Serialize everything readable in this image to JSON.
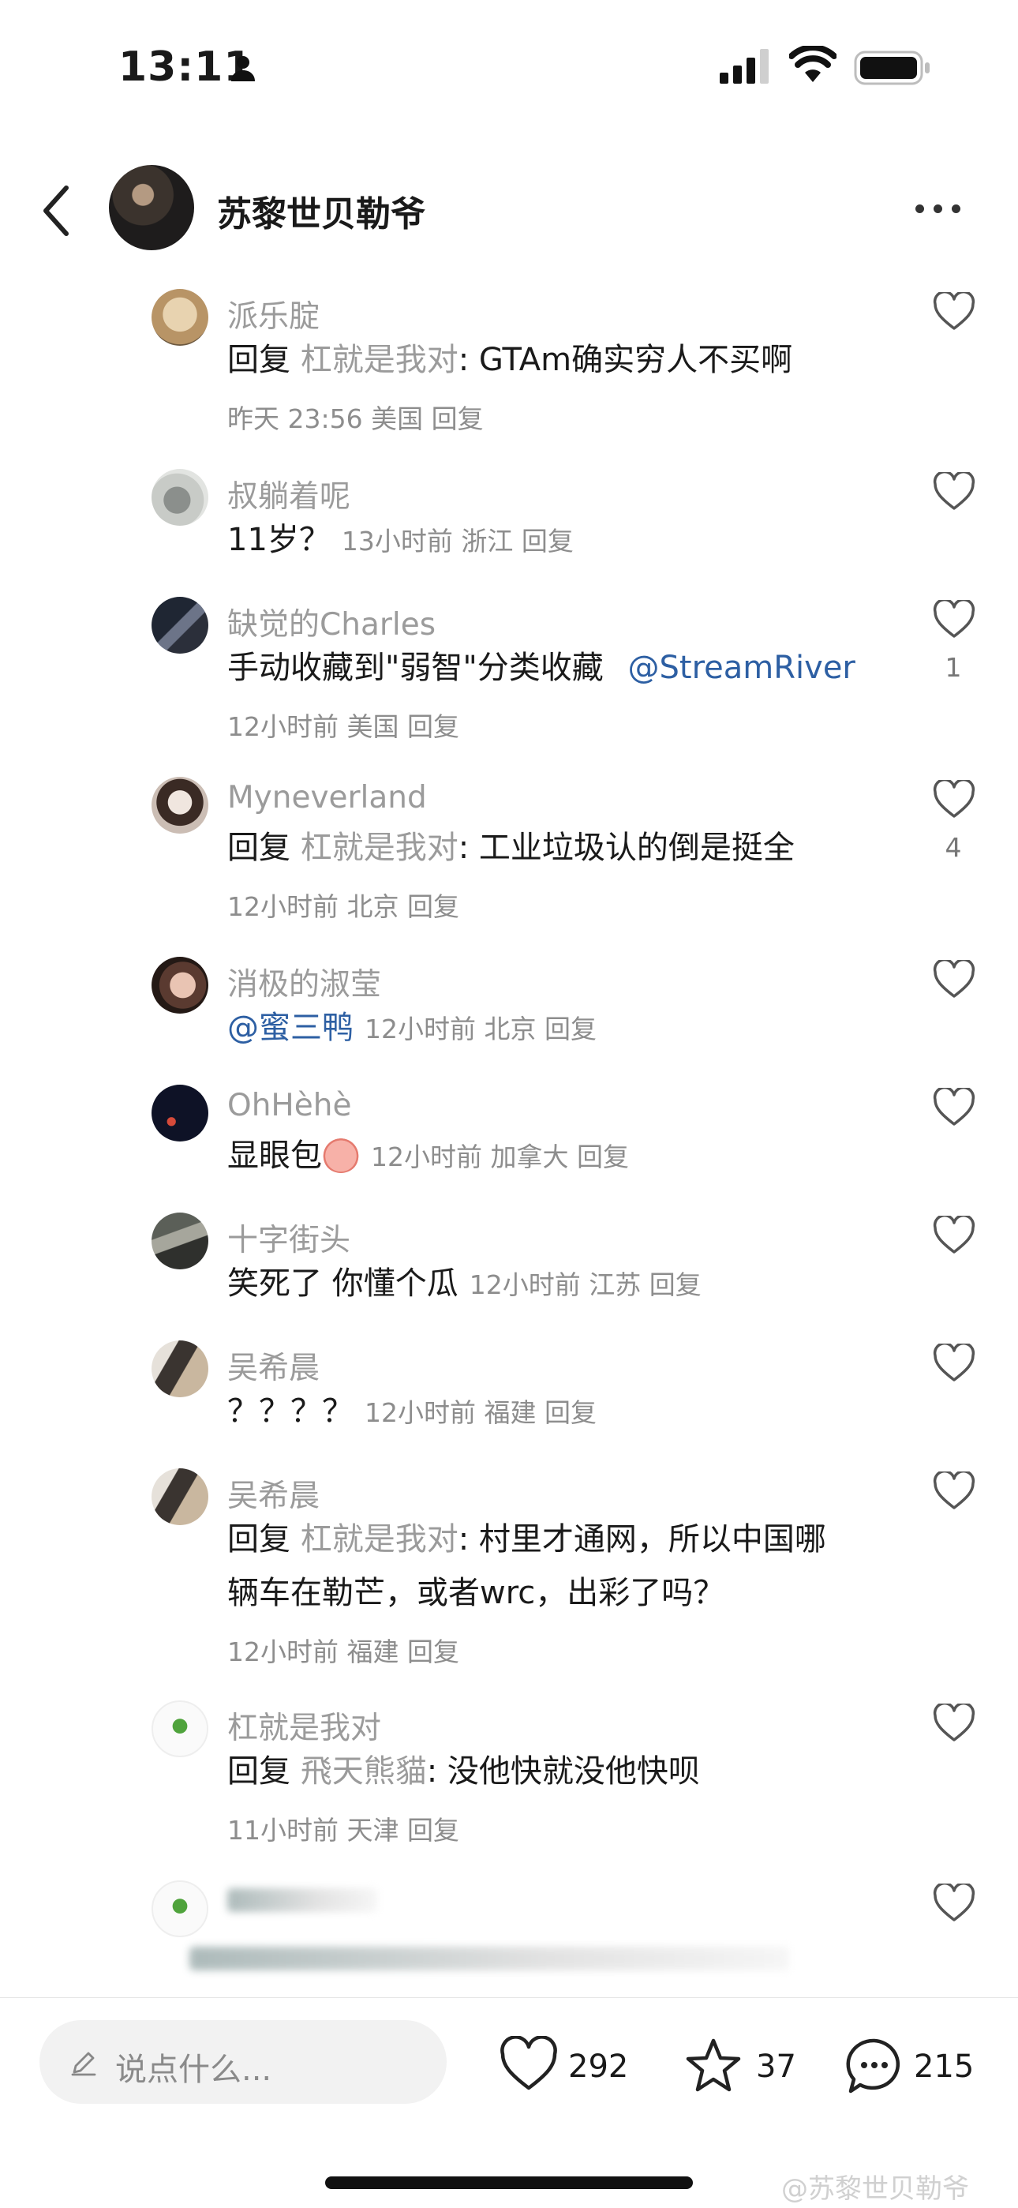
{
  "status_bar": {
    "time": "13:11"
  },
  "header": {
    "title": "苏黎世贝勒爷"
  },
  "comments": [
    {
      "name": "派乐腚",
      "reply_label": "回复",
      "reply_target": "杠就是我对",
      "text": ": GTAm确实穷人不买啊",
      "meta": "昨天 23:56 美国 回复"
    },
    {
      "name": "叔躺着呢",
      "text": "11岁？",
      "meta": "13小时前 浙江 回复"
    },
    {
      "name": "缺觉的Charles",
      "text": "手动收藏到\"弱智\"分类收藏",
      "mention": "@StreamRiver",
      "meta": "12小时前 美国 回复",
      "likes": "1"
    },
    {
      "name": "Myneverland",
      "reply_label": "回复",
      "reply_target": "杠就是我对",
      "text": ": 工业垃圾认的倒是挺全",
      "meta": "12小时前 北京 回复",
      "likes": "4"
    },
    {
      "name": "消极的淑莹",
      "mention": "@蜜三鸭",
      "meta": "12小时前 北京 回复"
    },
    {
      "name": "OhHèhè",
      "text": "显眼包",
      "meta": "12小时前 加拿大 回复"
    },
    {
      "name": "十字街头",
      "text": "笑死了 你懂个瓜",
      "meta": "12小时前 江苏 回复"
    },
    {
      "name": "吴希晨",
      "text": "？？？？",
      "meta": "12小时前 福建 回复"
    },
    {
      "name": "吴希晨",
      "reply_label": "回复",
      "reply_target": "杠就是我对",
      "text": ": 村里才通网，所以中国哪",
      "text2": "辆车在勒芒，或者wrc，出彩了吗？",
      "meta": "12小时前 福建 回复"
    },
    {
      "name": "杠就是我对",
      "reply_label": "回复",
      "reply_target": "飛天熊貓",
      "text": ": 没他快就没他快呗",
      "meta": "11小时前 天津 回复"
    }
  ],
  "toolbar": {
    "input_placeholder": "说点什么...",
    "likes": "292",
    "favorites": "37",
    "comments": "215"
  },
  "watermark": "@苏黎世贝勒爷",
  "colors": {
    "mention": "#2d5fa3",
    "secondary_text": "#9b9b9b"
  }
}
